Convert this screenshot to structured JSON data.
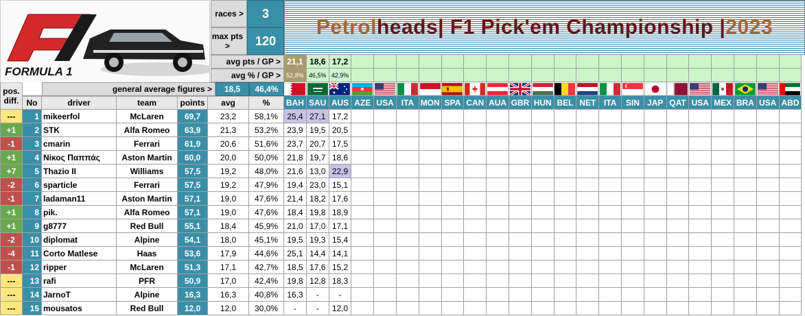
{
  "logo": {
    "wordmark": "FORMULA 1"
  },
  "summary": {
    "races_label": "races >",
    "races_value": "3",
    "max_pts_label": "max pts >",
    "max_pts_value": "120",
    "avg_pts_label": "avg pts / GP >",
    "avg_pct_label": "avg % / GP >",
    "general_label": "general average figures  >",
    "general_avg": "18,5",
    "general_pct": "46,4%"
  },
  "title": {
    "part1": "Petrol",
    "part2": "heads",
    "part3": " | F1 Pick'em Championship | ",
    "part4": "2023"
  },
  "gp_avg_pts": [
    "21,1",
    "18,6",
    "17,2"
  ],
  "gp_avg_pct": [
    "52,8%",
    "46,5%",
    "42,9%"
  ],
  "columns": {
    "pos_diff": "pos. diff.",
    "no": "No",
    "driver": "driver",
    "team": "team",
    "points": "points",
    "avg": "avg",
    "pct": "%"
  },
  "races": [
    {
      "code": "BAH",
      "flag": "bahrain"
    },
    {
      "code": "SAU",
      "flag": "saudi"
    },
    {
      "code": "AUS",
      "flag": "australia"
    },
    {
      "code": "AZE",
      "flag": "azerbaijan"
    },
    {
      "code": "USA",
      "flag": "usa"
    },
    {
      "code": "ITA",
      "flag": "italy"
    },
    {
      "code": "MON",
      "flag": "monaco"
    },
    {
      "code": "SPA",
      "flag": "spain"
    },
    {
      "code": "CAN",
      "flag": "canada"
    },
    {
      "code": "AUA",
      "flag": "austria"
    },
    {
      "code": "GBR",
      "flag": "uk"
    },
    {
      "code": "HUN",
      "flag": "hungary"
    },
    {
      "code": "BEL",
      "flag": "belgium"
    },
    {
      "code": "NET",
      "flag": "netherlands"
    },
    {
      "code": "ITA",
      "flag": "italy"
    },
    {
      "code": "SIN",
      "flag": "singapore"
    },
    {
      "code": "JAP",
      "flag": "japan"
    },
    {
      "code": "QAT",
      "flag": "qatar"
    },
    {
      "code": "USA",
      "flag": "usa"
    },
    {
      "code": "MEX",
      "flag": "mexico"
    },
    {
      "code": "BRA",
      "flag": "brazil"
    },
    {
      "code": "USA",
      "flag": "usa"
    },
    {
      "code": "ABD",
      "flag": "uae"
    }
  ],
  "rows": [
    {
      "diff": "---",
      "no": "1",
      "driver": "mikeerfol",
      "team": "McLaren",
      "points": "69,7",
      "avg": "23,2",
      "pct": "58,1%",
      "scores": [
        "25,4",
        "27,1",
        "17,2"
      ],
      "hl": [
        0,
        1
      ]
    },
    {
      "diff": "+1",
      "no": "2",
      "driver": "STK",
      "team": "Alfa Romeo",
      "points": "63,9",
      "avg": "21,3",
      "pct": "53,2%",
      "scores": [
        "23,9",
        "19,5",
        "20,5"
      ],
      "hl": []
    },
    {
      "diff": "-1",
      "no": "3",
      "driver": "cmarin",
      "team": "Ferrari",
      "points": "61,9",
      "avg": "20,6",
      "pct": "51,6%",
      "scores": [
        "23,7",
        "20,7",
        "17,5"
      ],
      "hl": []
    },
    {
      "diff": "+1",
      "no": "4",
      "driver": "Νίκος Παππάς",
      "team": "Aston Martin",
      "points": "60,0",
      "avg": "20,0",
      "pct": "50,0%",
      "scores": [
        "21,8",
        "19,7",
        "18,6"
      ],
      "hl": []
    },
    {
      "diff": "+7",
      "no": "5",
      "driver": "Thazio II",
      "team": "Williams",
      "points": "57,5",
      "avg": "19,2",
      "pct": "48,0%",
      "scores": [
        "21,6",
        "13,0",
        "22,9"
      ],
      "hl": [
        2
      ]
    },
    {
      "diff": "-2",
      "no": "6",
      "driver": "sparticle",
      "team": "Ferrari",
      "points": "57,5",
      "avg": "19,2",
      "pct": "47,9%",
      "scores": [
        "19,4",
        "23,0",
        "15,1"
      ],
      "hl": []
    },
    {
      "diff": "-1",
      "no": "7",
      "driver": "ladaman11",
      "team": "Aston Martin",
      "points": "57,1",
      "avg": "19,0",
      "pct": "47,6%",
      "scores": [
        "21,4",
        "18,2",
        "17,6"
      ],
      "hl": []
    },
    {
      "diff": "+1",
      "no": "8",
      "driver": "pik.",
      "team": "Alfa Romeo",
      "points": "57,1",
      "avg": "19,0",
      "pct": "47,6%",
      "scores": [
        "18,4",
        "19,8",
        "18,9"
      ],
      "hl": []
    },
    {
      "diff": "+1",
      "no": "9",
      "driver": "g8777",
      "team": "Red Bull",
      "points": "55,1",
      "avg": "18,4",
      "pct": "45,9%",
      "scores": [
        "21,0",
        "17,0",
        "17,1"
      ],
      "hl": []
    },
    {
      "diff": "-2",
      "no": "10",
      "driver": "diplomat",
      "team": "Alpine",
      "points": "54,1",
      "avg": "18,0",
      "pct": "45,1%",
      "scores": [
        "19,5",
        "19,3",
        "15,4"
      ],
      "hl": []
    },
    {
      "diff": "-4",
      "no": "11",
      "driver": "Corto Matlese",
      "team": "Haas",
      "points": "53,6",
      "avg": "17,9",
      "pct": "44,6%",
      "scores": [
        "25,1",
        "14,4",
        "14,1"
      ],
      "hl": []
    },
    {
      "diff": "-1",
      "no": "12",
      "driver": "ripper",
      "team": "McLaren",
      "points": "51,3",
      "avg": "17,1",
      "pct": "42,7%",
      "scores": [
        "18,5",
        "17,6",
        "15,2"
      ],
      "hl": []
    },
    {
      "diff": "---",
      "no": "13",
      "driver": "rafi",
      "team": "PFR",
      "points": "50,9",
      "avg": "17,0",
      "pct": "42,4%",
      "scores": [
        "19,8",
        "12,8",
        "18,3"
      ],
      "hl": []
    },
    {
      "diff": "---",
      "no": "14",
      "driver": "JarnoT",
      "team": "Alpine",
      "points": "16,3",
      "avg": "16,3",
      "pct": "40,8%",
      "scores": [
        "16,3",
        "-",
        "-"
      ],
      "hl": []
    },
    {
      "diff": "---",
      "no": "15",
      "driver": "mousatos",
      "team": "Red Bull",
      "points": "12,0",
      "avg": "12,0",
      "pct": "30,0%",
      "scores": [
        "-",
        "-",
        "12,0"
      ],
      "hl": []
    }
  ],
  "colors": {
    "accent": "#3a8fa8",
    "diff_up": "#6aa84f",
    "diff_down": "#c0504d",
    "diff_same": "#ffe680",
    "highlight": "#c9c2e6",
    "stat_bg": "#ccf5cc"
  }
}
